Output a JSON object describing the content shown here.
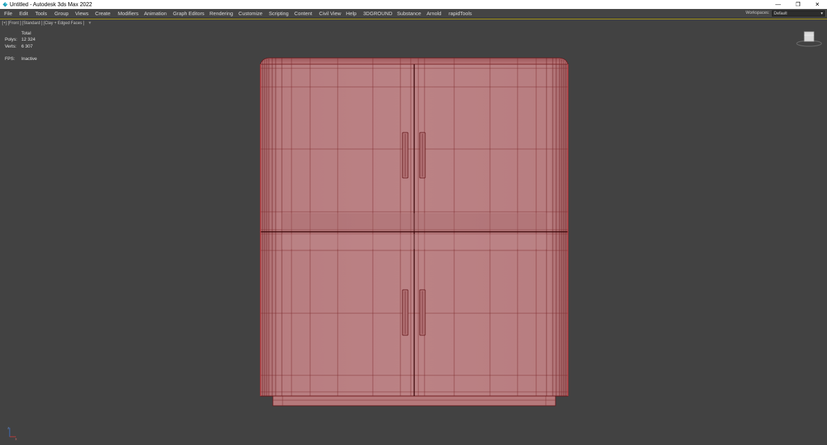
{
  "window": {
    "title": "Untitled - Autodesk 3ds Max 2022",
    "controls": {
      "minimize": "—",
      "restore": "❐",
      "close": "✕"
    }
  },
  "menubar": {
    "items": [
      "File",
      "Edit",
      "Tools",
      "Group",
      "Views",
      "Create",
      "Modifiers",
      "Animation",
      "Graph Editors",
      "Rendering",
      "Customize",
      "Scripting",
      "Content",
      "Civil View",
      "Help",
      "3DGROUND",
      "Substance",
      "Arnold",
      "rapidTools"
    ],
    "workspaces_label": "Workspaces:",
    "workspace_value": "Default"
  },
  "viewport": {
    "label": "[+] [Front ] [Standard ] [Clay + Edged Faces ]",
    "stats": {
      "header": "Total",
      "polys_label": "Polys:",
      "polys_value": "12 324",
      "verts_label": "Verts:",
      "verts_value": "6 307",
      "fps_label": "FPS:",
      "fps_value": "Inactive"
    },
    "active_border_color": "#b8a51d"
  },
  "model": {
    "fill_color": "#b5797b",
    "wire_color": "#7a1a1d",
    "outline_color": "#c8343a"
  }
}
